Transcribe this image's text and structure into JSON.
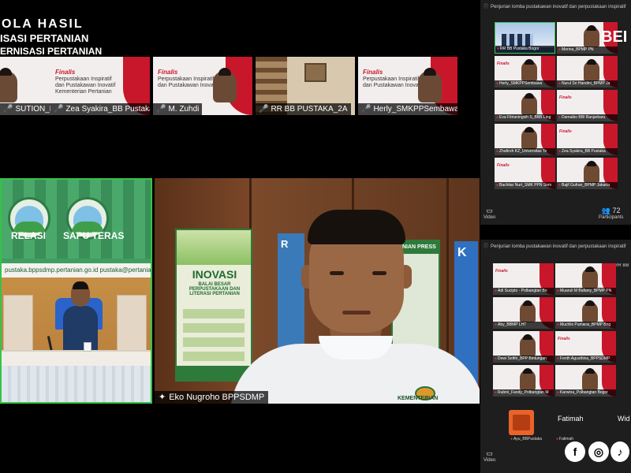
{
  "banner": {
    "line1": "OLA HASIL",
    "line2": "ISASI PERTANIAN",
    "line3": "ERNISASI PERTANIAN"
  },
  "slide": {
    "heading": "Finalis",
    "line_a": "Perpustakaan Inspiratif",
    "line_b": "dan Pustakawan Inovatif",
    "line_c": "Kementerian Pertanian"
  },
  "top_strip": [
    {
      "name": "SUTION_BBP"
    },
    {
      "name": "Zea Syakira_BB Pustaka"
    },
    {
      "name": "M. Zuhdi"
    },
    {
      "name": "RR BB PUSTAKA_2A"
    },
    {
      "name": "Herly_SMKPPSembawa"
    }
  ],
  "left_tile": {
    "poster_left": "RELASI",
    "poster_right": "SAPU TERAS",
    "url_text": "pustaka.bppsdmp.pertanian.go.id   pustaka@pertanian.go.id"
  },
  "main_tile": {
    "name": "Eko Nugroho BPPSDMP",
    "poster_title": "INOVASI",
    "poster_sub": "BALAI BESAR PERPUSTAKAAN DAN LITERASI PERTANIAN",
    "poster_press": "TANIAN PRESS",
    "poster_r": "R",
    "poster_k": "K",
    "logo_text": "KEMENTERIAN"
  },
  "panel_top": {
    "title": "Penjurian lomba pustakawan inovatif dan perpustakaan inspiratif",
    "tiles": [
      {
        "name": "RR BB Pustaka Bogor"
      },
      {
        "name": "Merina_BPMP PN"
      },
      {
        "name": "Herly_SMKPPSembawa"
      },
      {
        "name": "Nurul Sri Handini_BPMP Ja"
      },
      {
        "name": "Eva Fitrianingsih S_BBB Ling"
      },
      {
        "name": "Damaibo BBI Banjarbaru"
      },
      {
        "name": "Zhafiroh KZ_Universitas Te"
      },
      {
        "name": "Zea Syakira_BB Pustaka"
      },
      {
        "name": "Bachtiar Nurt_SMK PPN Sem"
      },
      {
        "name": "Bajif Gufran_BPMP Jakarta"
      }
    ],
    "video_label": "Video",
    "participants_label": "Participants",
    "participants_count": "72",
    "right_big": "BEI"
  },
  "panel_bottom": {
    "title": "Penjurian lomba pustakawan inovatif dan perpustakaan inspiratif",
    "side_tag": "RR BB",
    "tiles": [
      {
        "name": "Adi Sucipto - Polbangtan Bo"
      },
      {
        "name": "Muaruli M Bafiany_BPMP PN"
      },
      {
        "name": "Aby_BBMP LHT"
      },
      {
        "name": "Muchlis Pumarai_BPMP Bng"
      },
      {
        "name": "Dewi Setthi_BPP Bintungan"
      },
      {
        "name": "Fenth Agusthina_BPPSDMP"
      },
      {
        "name": "Rubini_Fandy_Polbangtan M"
      },
      {
        "name": "Karwina_Polbangtan Bogor"
      }
    ],
    "bottom_left_name": "Ayu_BBPustaka",
    "bottom_mid_name": "Fatimah",
    "bottom_mid_label": "Fatimah",
    "bottom_right_name": "Wid",
    "video_label": "Video"
  },
  "social": {
    "facebook": "f",
    "instagram": "◎",
    "tiktok": "♪"
  },
  "colors": {
    "accent_red": "#c8172a",
    "active_green": "#35c34a",
    "panel_bg": "#1e1e1e"
  }
}
